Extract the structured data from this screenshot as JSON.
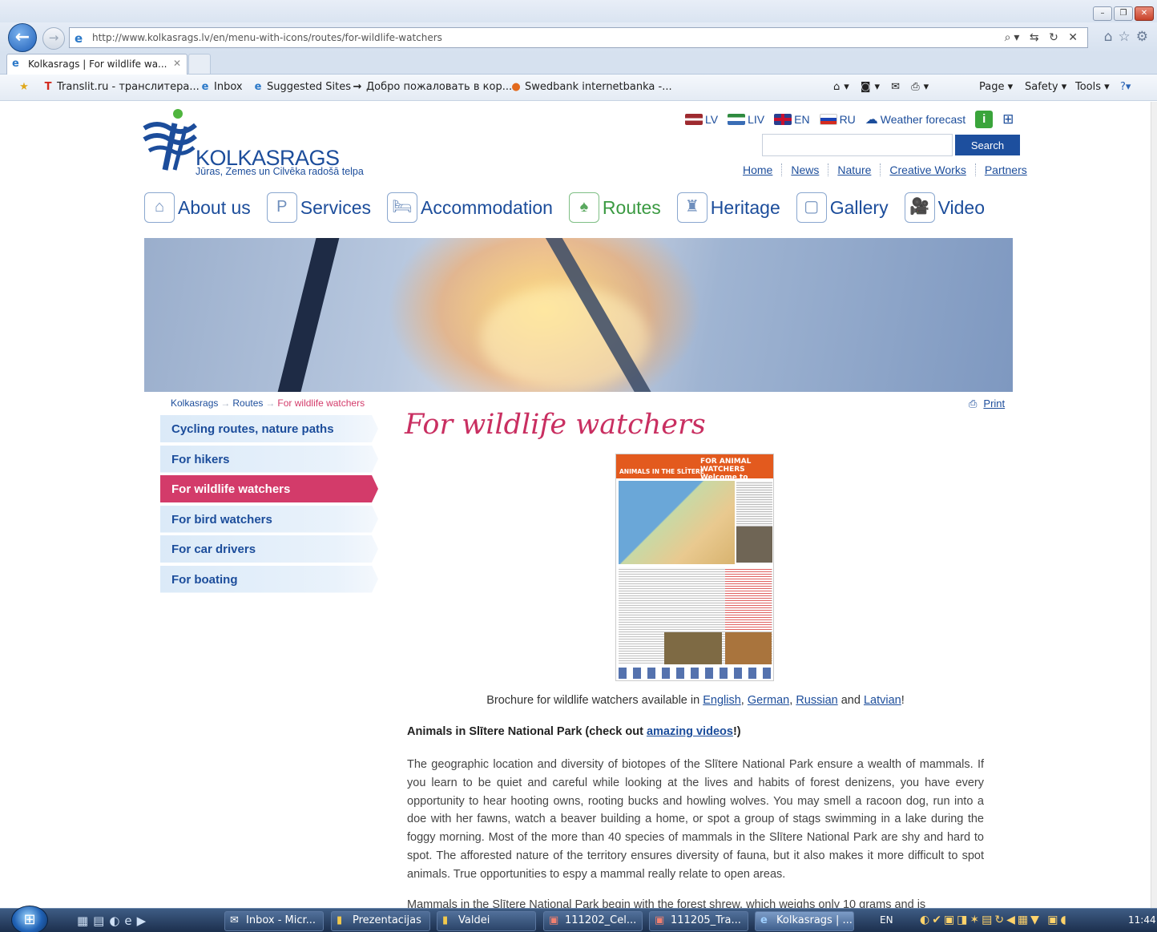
{
  "browser": {
    "address_url": "http://www.kolkasrags.lv/en/menu-with-icons/routes/for-wildlife-watchers",
    "tab_title": "Kolkasrags | For wildlife wa...",
    "favorites": [
      {
        "label": "Translit.ru - транслитера...",
        "icon": "T"
      },
      {
        "label": "Inbox",
        "icon": "e"
      },
      {
        "label": "Suggested Sites",
        "icon": "e"
      },
      {
        "label": "Добро пожаловать в кор...",
        "icon": "→"
      },
      {
        "label": "Swedbank internetbanka -...",
        "icon": "●"
      }
    ],
    "commands": {
      "page": "Page ▾",
      "safety": "Safety ▾",
      "tools": "Tools ▾"
    }
  },
  "site": {
    "logo_name": "KOLKASRAGS",
    "logo_tagline": "Jūras, Zemes un Cilvēka radošā telpa",
    "languages": [
      "LV",
      "LIV",
      "EN",
      "RU"
    ],
    "weather": "Weather forecast",
    "search_button": "Search",
    "search_value": "",
    "top_links": [
      "Home",
      "News",
      "Nature",
      "Creative Works",
      "Partners"
    ],
    "main_nav": [
      {
        "label": "About us",
        "icon": "⌂"
      },
      {
        "label": "Services",
        "icon": "P"
      },
      {
        "label": "Accommodation",
        "icon": "🛏"
      },
      {
        "label": "Routes",
        "icon": "♠"
      },
      {
        "label": "Heritage",
        "icon": "♜"
      },
      {
        "label": "Gallery",
        "icon": "▢"
      },
      {
        "label": "Video",
        "icon": "🎥"
      }
    ],
    "active_nav": "Routes"
  },
  "breadcrumb": [
    "Kolkasrags",
    "Routes",
    "For wildlife watchers"
  ],
  "print_label": "Print",
  "sidebar": [
    "Cycling routes, nature paths",
    "For hikers",
    "For wildlife watchers",
    "For bird watchers",
    "For car drivers",
    "For boating"
  ],
  "sidebar_active": "For wildlife watchers",
  "page_title": "For wildlife watchers",
  "brochure_image": {
    "header_left": "ANIMALS IN THE SLĪTERE",
    "header_right": "FOR ANIMAL WATCHERS  Welcome to Slītere!"
  },
  "content": {
    "brochure_prefix": "Brochure for wildlife watchers available in ",
    "brochure_links": [
      "English",
      "German",
      "Russian",
      "Latvian"
    ],
    "sep1": ", ",
    "sep2": ", ",
    "sep3": " and ",
    "brochure_suffix": "!",
    "heading_prefix": "Animals in Slītere National Park (check out ",
    "heading_link": "amazing videos",
    "heading_suffix": "!)",
    "paragraph1": "The geographic location and diversity of biotopes of the Slītere National Park ensure a wealth of mammals. If you learn to be quiet and careful while looking at the lives and habits of forest denizens, you have every opportunity to hear hooting owns, rooting bucks and howling wolves. You may smell a racoon dog, run into a doe with her fawns, watch a beaver building a home, or spot a group of stags swimming in a lake during the foggy morning. Most of the more than 40 species of mammals in the Slītere National Park are shy and hard to spot. The afforested nature of the territory ensures diversity of fauna, but it also makes it more difficult to spot animals. True opportunities to espy a mammal really relate to open areas.",
    "paragraph2_partial": "Mammals in the Slītere National Park begin with the forest shrew, which weighs only 10 grams and is"
  },
  "taskbar": {
    "tasks": [
      {
        "label": "Inbox - Micr...",
        "icon": "✉"
      },
      {
        "label": "Prezentacijas",
        "icon": "▮"
      },
      {
        "label": "Valdei",
        "icon": "▮"
      },
      {
        "label": "111202_Cel...",
        "icon": "▣"
      },
      {
        "label": "111205_Tra...",
        "icon": "▣"
      },
      {
        "label": "Kolkasrags | ...",
        "icon": "e"
      }
    ],
    "language": "EN",
    "clock": "11:44"
  },
  "colors": {
    "brand_blue": "#1c4d9b",
    "accent_pink": "#d33b6a",
    "active_green": "#3b9a42"
  }
}
